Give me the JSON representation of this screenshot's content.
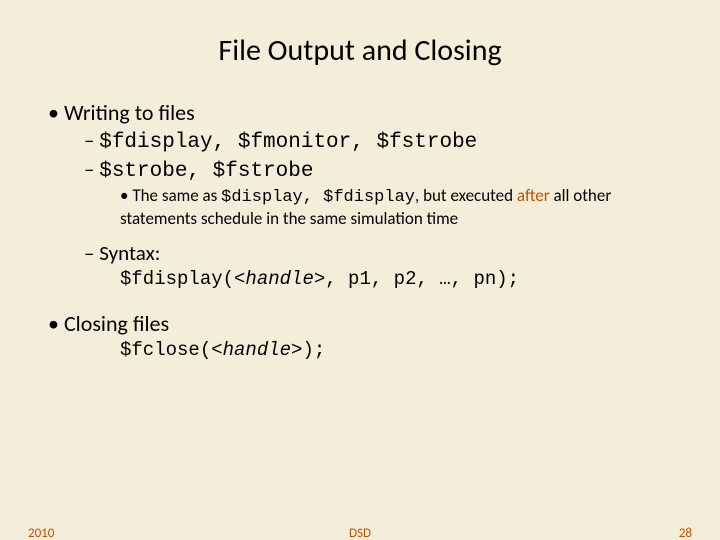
{
  "title": "File Output and Closing",
  "b1": {
    "heading": "Writing to files",
    "line1": "$fdisplay, $fmonitor, $fstrobe",
    "line2": "$strobe, $fstrobe",
    "note_a": "The same as ",
    "note_code": "$display, $fdisplay",
    "note_b": ", but executed ",
    "note_accent": "after",
    "note_c": " all other statements schedule in the same simulation time",
    "syntax_label": "Syntax:",
    "syntax_a": "$fdisplay(",
    "syntax_handle": "<handle>",
    "syntax_b": ", p1, p2, …, pn);"
  },
  "b2": {
    "heading": "Closing files",
    "code_a": "$fclose(",
    "code_handle": "<handle>",
    "code_b": ");"
  },
  "footer": {
    "year": "2010",
    "mid": "DSD",
    "page": "28"
  }
}
